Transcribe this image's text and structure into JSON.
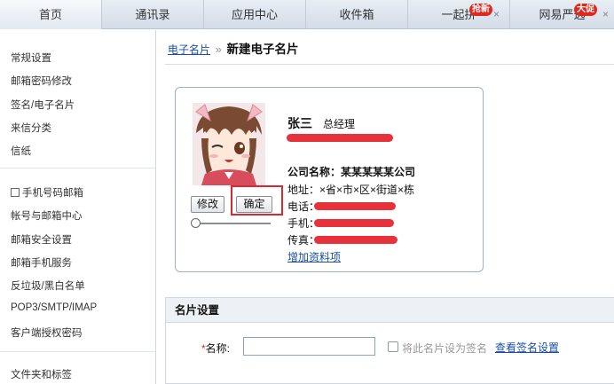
{
  "tabs": [
    {
      "label": "首页"
    },
    {
      "label": "通讯录"
    },
    {
      "label": "应用中心"
    },
    {
      "label": "收件箱"
    },
    {
      "label": "一起拼",
      "badge": "抢新"
    },
    {
      "label": "网易严选",
      "badge": "大促"
    }
  ],
  "tab_close_glyph": "×",
  "sidebar": {
    "group1": [
      "常规设置",
      "邮箱密码修改",
      "签名/电子名片",
      "来信分类",
      "信纸"
    ],
    "group2": [
      "手机号码邮箱",
      "帐号与邮箱中心",
      "邮箱安全设置",
      "邮箱手机服务",
      "反垃圾/黑白名单",
      "POP3/SMTP/IMAP",
      "客户端授权密码"
    ],
    "group3": [
      "文件夹和标签"
    ]
  },
  "breadcrumb": {
    "link": "电子名片",
    "separator": "»",
    "current": "新建电子名片"
  },
  "card": {
    "name": "张三",
    "job_title": "总经理",
    "company_label": "公司名称：",
    "company_value": "某某某某某公司",
    "address_label": "地址：",
    "address_value": "×省×市×区×街道×栋",
    "phone_label": "电话：",
    "mobile_label": "手机：",
    "fax_label": "传真：",
    "add_field_link": "增加资料项",
    "edit_button": "修改",
    "confirm_button": "确定"
  },
  "settings": {
    "title": "名片设置",
    "name_label": "名称:",
    "required_mark": "*",
    "name_value": "",
    "signature_checkbox_label": "将此名片设为签名",
    "view_signature_link": "查看签名设置"
  },
  "colors": {
    "highlight": "#d9282f",
    "link": "#1c4fa3",
    "redaction": "#e5212b"
  }
}
